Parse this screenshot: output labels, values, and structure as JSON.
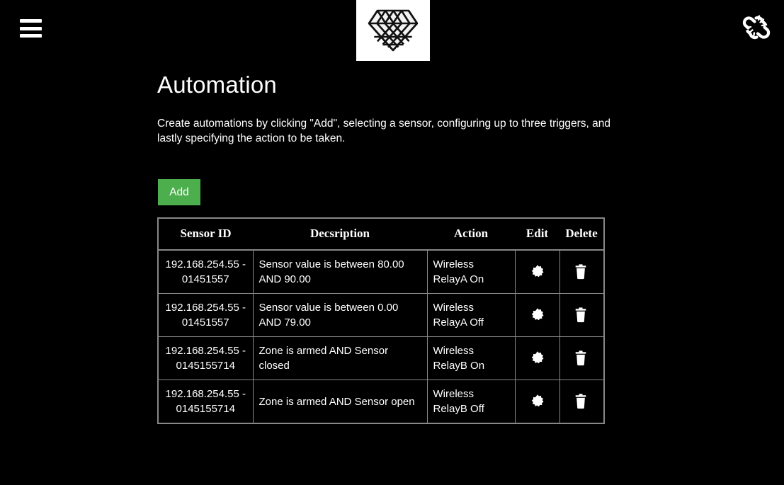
{
  "header": {
    "menu_icon": "hamburger-menu-icon",
    "logo_icon": "diamond-logo-icon",
    "connection_icon": "broken-link-icon"
  },
  "page": {
    "title": "Automation",
    "description": "Create automations by clicking \"Add\", selecting a sensor, configuring up to three triggers, and lastly specifying the action to be taken."
  },
  "toolbar": {
    "add_label": "Add",
    "add_color": "#4cae4c"
  },
  "table": {
    "columns": [
      "Sensor ID",
      "Decsription",
      "Action",
      "Edit",
      "Delete"
    ],
    "border_color": "#888888",
    "edit_icon": "gear-icon",
    "delete_icon": "trash-icon",
    "rows": [
      {
        "sensor_id": "192.168.254.55 - 01451557",
        "description": "Sensor value is between 80.00 AND 90.00",
        "action": "Wireless RelayA On"
      },
      {
        "sensor_id": "192.168.254.55 - 01451557",
        "description": "Sensor value is between 0.00 AND 79.00",
        "action": "Wireless RelayA Off"
      },
      {
        "sensor_id": "192.168.254.55 - 0145155714",
        "description": "Zone is armed AND Sensor closed",
        "action": "Wireless RelayB On"
      },
      {
        "sensor_id": "192.168.254.55 - 0145155714",
        "description": "Zone is armed AND Sensor open",
        "action": "Wireless RelayB Off"
      }
    ]
  }
}
